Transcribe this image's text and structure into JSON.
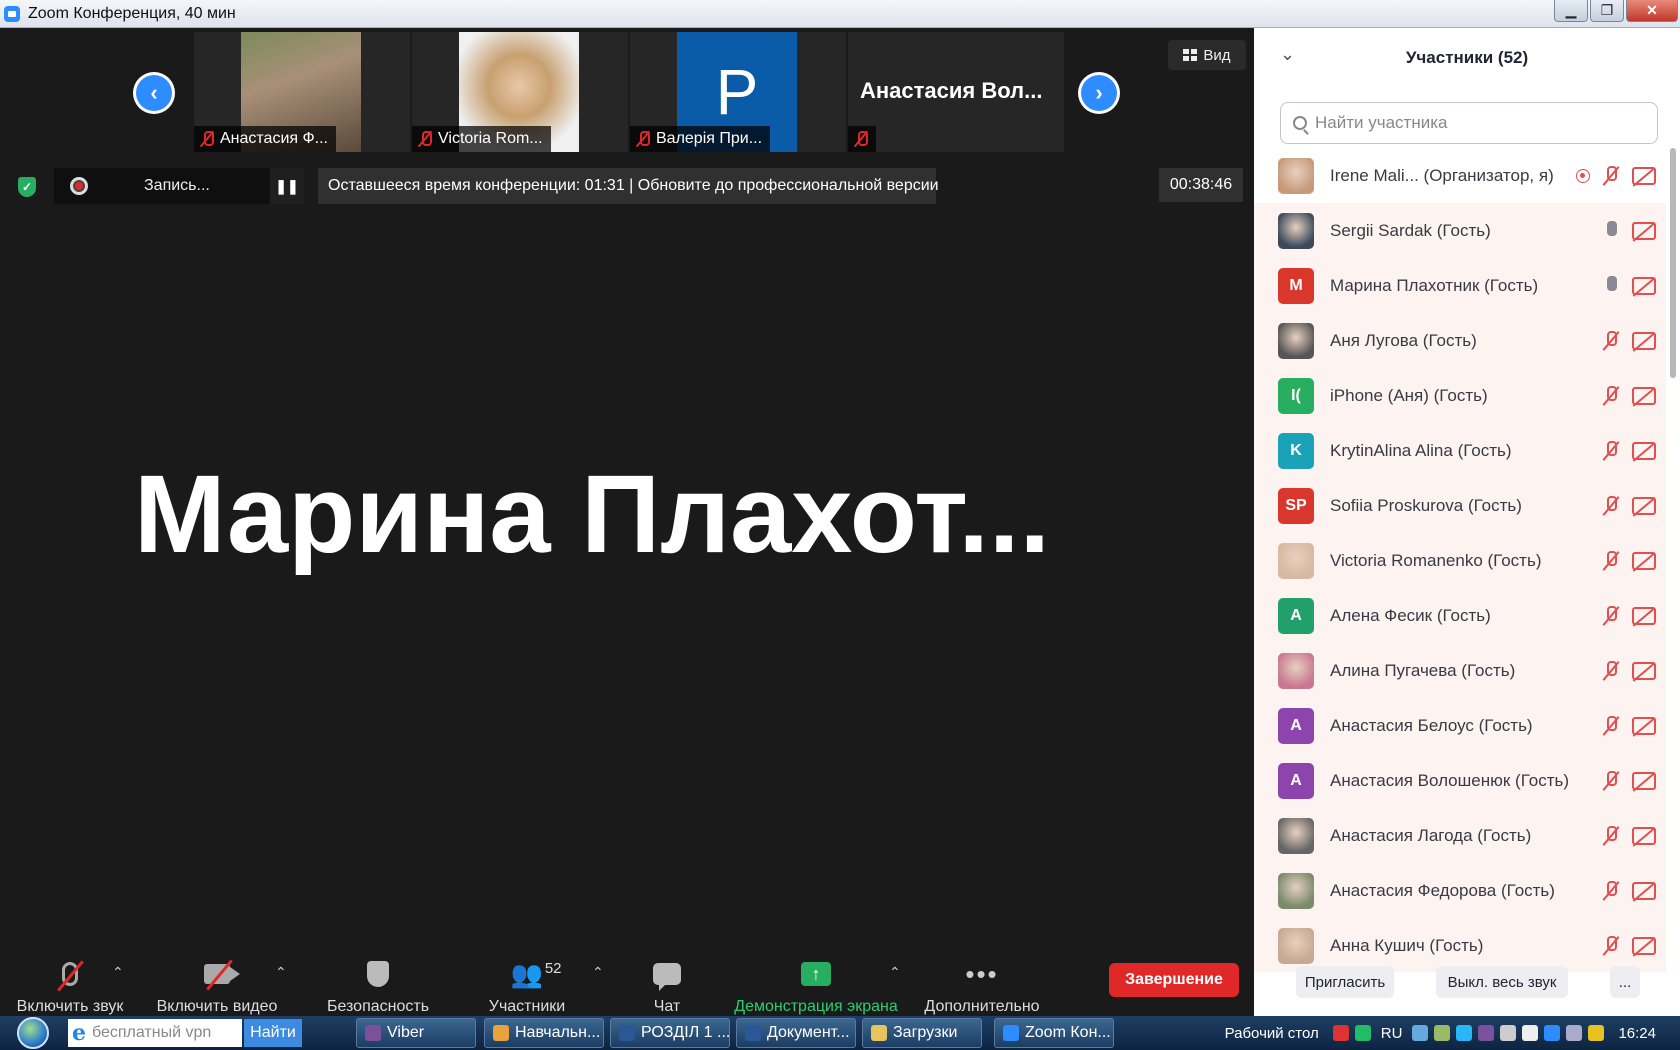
{
  "window": {
    "title": "Zoom Конференция, 40 мин",
    "minimize": "▁",
    "maximize": "❐",
    "close": "✕"
  },
  "thumbnails": {
    "prev_label": "‹",
    "next_label": "›",
    "items": [
      {
        "name": "Анастасия Ф...",
        "has_photo": true
      },
      {
        "name": "Victoria Rom...",
        "has_photo": true
      },
      {
        "name": "Валерія При...",
        "initial": "P",
        "color": "#0a5ca8"
      },
      {
        "name": "Анастасия  Вол...",
        "text_only": true
      }
    ],
    "view_label": "Вид"
  },
  "status": {
    "recording_label": "Запись...",
    "pause_label": "❚❚",
    "notice": "Оставшееся время конференции: 01:31 | Обновите до профессиональной версии",
    "timer": "00:38:46",
    "security_glyph": "✓"
  },
  "active_speaker": "Марина  Плахот...",
  "toolbar": {
    "mute_label": "Включить звук",
    "video_label": "Включить видео",
    "security_label": "Безопасность",
    "participants_label": "Участники",
    "participants_count": "52",
    "chat_label": "Чат",
    "share_label": "Демонстрация экрана",
    "more_label": "Дополнительно",
    "end_label": "Завершение",
    "caret": "⌃",
    "people_glyph": "👥",
    "dots_glyph": "•••",
    "share_glyph": "↑"
  },
  "participants": {
    "title": "Участники (52)",
    "collapse_glyph": "⌄",
    "search_placeholder": "Найти участника",
    "list": [
      {
        "name": "Irene Mali...  (Организатор, я)",
        "avatar": "photo",
        "color": "#c69a7a",
        "mic": "muted",
        "host": true
      },
      {
        "name": "Sergii Sardak (Гость)",
        "avatar": "photo",
        "color": "#3a4a5a",
        "mic": "on"
      },
      {
        "name": "Марина Плахотник (Гость)",
        "avatar": "М",
        "color": "#d9372b",
        "mic": "on"
      },
      {
        "name": "Аня Лугова (Гость)",
        "avatar": "photo",
        "color": "#555555",
        "mic": "muted"
      },
      {
        "name": "iPhone (Аня) (Гость)",
        "avatar": "I(",
        "color": "#27ae60",
        "mic": "muted"
      },
      {
        "name": "KrytinAlina Alina (Гость)",
        "avatar": "K",
        "color": "#1aa3b8",
        "mic": "muted"
      },
      {
        "name": "Sofiia Proskurova (Гость)",
        "avatar": "SP",
        "color": "#d9372b",
        "mic": "muted"
      },
      {
        "name": "Victoria Romanenko (Гость)",
        "avatar": "photo",
        "color": "#d8b8a0",
        "mic": "muted"
      },
      {
        "name": "Алена Фесик (Гость)",
        "avatar": "A",
        "color": "#22a06b",
        "mic": "muted"
      },
      {
        "name": "Алина Пугачева (Гость)",
        "avatar": "photo",
        "color": "#c87890",
        "mic": "muted"
      },
      {
        "name": "Анастасия Белоус (Гость)",
        "avatar": "A",
        "color": "#8e44ad",
        "mic": "muted"
      },
      {
        "name": "Анастасия Волошенюк (Гость)",
        "avatar": "A",
        "color": "#8e44ad",
        "mic": "muted"
      },
      {
        "name": "Анастасия Лагода (Гость)",
        "avatar": "photo",
        "color": "#666666",
        "mic": "muted"
      },
      {
        "name": "Анастасия Федорова (Гость)",
        "avatar": "photo",
        "color": "#7a8a6a",
        "mic": "muted"
      },
      {
        "name": "Анна Кушич (Гость)",
        "avatar": "photo",
        "color": "#c8a890",
        "mic": "muted"
      }
    ],
    "invite_label": "Пригласить",
    "mute_all_label": "Выкл. весь звук",
    "more_label": "..."
  },
  "taskbar": {
    "search_value": "бесплатный vpn",
    "find_label": "Найти",
    "items": [
      {
        "label": "Viber",
        "color": "#7b519d"
      },
      {
        "label": "Навчальн...",
        "color": "#e8a33a"
      },
      {
        "label": "РОЗДІЛ 1 ...",
        "color": "#2b5797"
      },
      {
        "label": "Документ...",
        "color": "#2b5797"
      },
      {
        "label": "Загрузки",
        "color": "#e8c45a"
      },
      {
        "label": "Zoom Кон...",
        "color": "#2d8cff"
      }
    ],
    "desktop_label": "Рабочий стол",
    "lang": "RU",
    "clock": "16:24"
  }
}
